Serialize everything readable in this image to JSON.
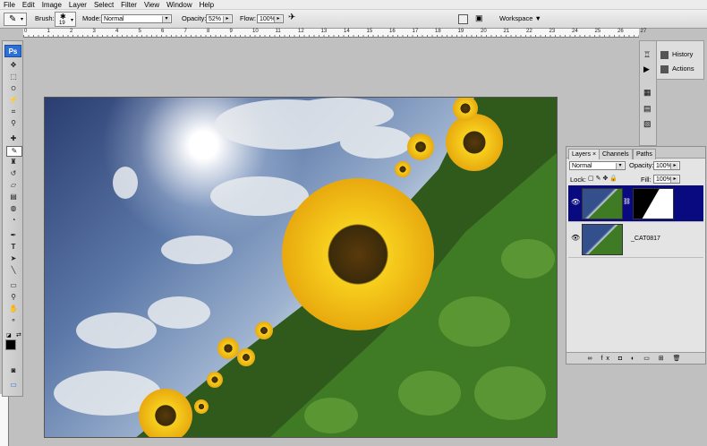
{
  "menu": [
    "File",
    "Edit",
    "Image",
    "Layer",
    "Select",
    "Filter",
    "View",
    "Window",
    "Help"
  ],
  "options": {
    "brush_label": "Brush:",
    "brush_size": "19",
    "mode_label": "Mode:",
    "mode_value": "Normal",
    "opacity_label": "Opacity:",
    "opacity_value": "52%",
    "flow_label": "Flow:",
    "flow_value": "100%",
    "workspace_label": "Workspace ▼"
  },
  "ruler_marks": [
    "0",
    "1",
    "2",
    "3",
    "4",
    "5",
    "6",
    "7",
    "8",
    "9",
    "10",
    "11",
    "12",
    "13",
    "14",
    "15",
    "16",
    "17",
    "18",
    "19",
    "20",
    "21",
    "22",
    "23",
    "24",
    "25",
    "26",
    "27"
  ],
  "toolbox": {
    "app_badge": "Ps"
  },
  "dock": {
    "history_label": "History",
    "actions_label": "Actions"
  },
  "layers_panel": {
    "tabs": [
      "Layers ×",
      "Channels",
      "Paths"
    ],
    "blend_mode": "Normal",
    "opacity_label": "Opacity:",
    "opacity_value": "100%",
    "lock_label": "Lock:",
    "fill_label": "Fill:",
    "fill_value": "100%",
    "layers": [
      {
        "name": "",
        "selected": true
      },
      {
        "name": "_CAT0817",
        "selected": false
      }
    ],
    "footer_icons": "∞ fx ◘ ◐ ▭ ⊞ 🗑"
  },
  "colors": {
    "accent": "#000080",
    "ps_badge": "#2e6fd4",
    "sunflower": "#f2c21a"
  }
}
